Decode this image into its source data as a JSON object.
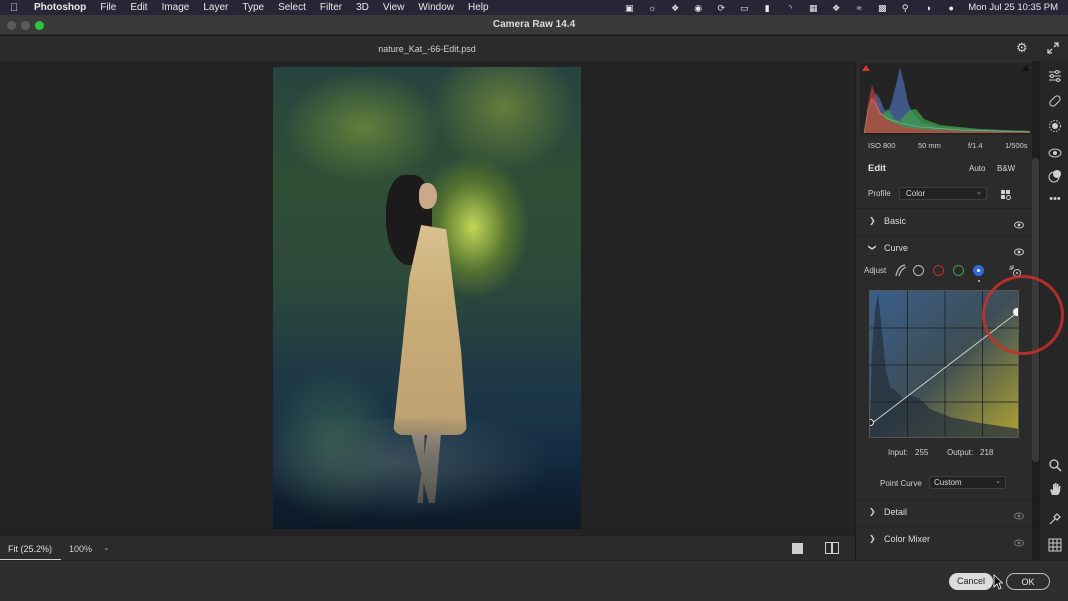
{
  "menubar": {
    "app": "Photoshop",
    "items": [
      "File",
      "Edit",
      "Image",
      "Layer",
      "Type",
      "Select",
      "Filter",
      "3D",
      "View",
      "Window",
      "Help"
    ],
    "clock": "Mon Jul 25  10:35 PM"
  },
  "window": {
    "title": "Camera Raw 14.4"
  },
  "file": {
    "name": "nature_Kat_-66-Edit.psd"
  },
  "statusbar": {
    "fit_label": "Fit (25.2%)",
    "zoom_label": "100%"
  },
  "exif": {
    "iso": "ISO 800",
    "focal": "50 mm",
    "aperture": "f/1.4",
    "shutter": "1/500s"
  },
  "edit": {
    "title": "Edit",
    "auto": "Auto",
    "bw": "B&W",
    "profile_label": "Profile",
    "profile_value": "Color"
  },
  "sections": {
    "basic": "Basic",
    "curve": "Curve",
    "detail": "Detail",
    "color_mixer": "Color Mixer"
  },
  "curve": {
    "adjust_label": "Adjust",
    "input_label": "Input:",
    "input_value": "255",
    "output_label": "Output:",
    "output_value": "218",
    "point_curve_label": "Point Curve",
    "point_curve_value": "Custom",
    "active_channel": "blue"
  },
  "buttons": {
    "cancel": "Cancel",
    "ok": "OK"
  },
  "colors": {
    "accent_blue": "#2f6bd8",
    "annotation_red": "#c9302c",
    "maximize_green": "#2cc840"
  }
}
